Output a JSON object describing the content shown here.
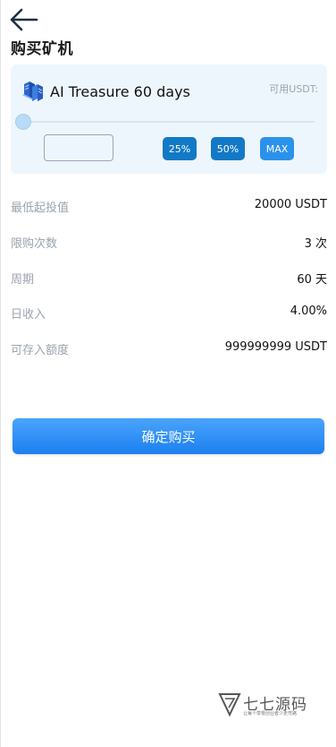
{
  "header": {
    "title": "购买矿机"
  },
  "product": {
    "name": "AI Treasure 60 days",
    "available_label": "可用USDT:"
  },
  "slider": {
    "value_percent": 0
  },
  "amount_input": {
    "value": "",
    "placeholder": ""
  },
  "quick_buttons": {
    "p25": "25%",
    "p50": "50%",
    "max": "MAX"
  },
  "details": [
    {
      "label": "最低起投值",
      "value": "20000 USDT"
    },
    {
      "label": "限购次数",
      "value": "3 次"
    },
    {
      "label": "周期",
      "value": "60 天"
    },
    {
      "label": "日收入",
      "value": "4.00%"
    },
    {
      "label": "可存入额度",
      "value": "999999999 USDT"
    }
  ],
  "confirm_button": "确定购买",
  "watermark": {
    "title": "七七源码",
    "subtitle": "让每个草根创业者少走弯路"
  },
  "colors": {
    "accent": "#1c7ff0",
    "card_bg": "#eef6fd",
    "label_gray": "#9aa3ad"
  }
}
